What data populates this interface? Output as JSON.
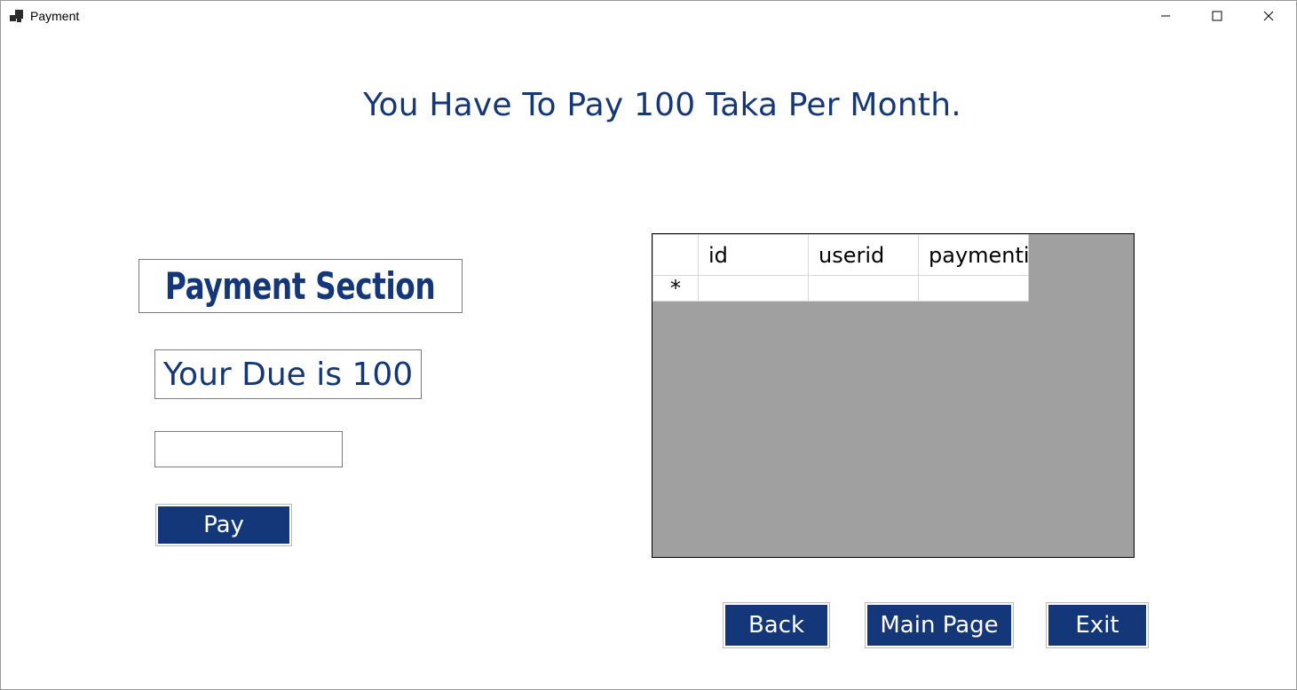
{
  "window": {
    "title": "Payment"
  },
  "headline": "You Have To Pay 100 Taka Per Month.",
  "section": {
    "title": "Payment Section"
  },
  "due": {
    "text": "Your Due is 100"
  },
  "amount_input": {
    "value": "",
    "placeholder": ""
  },
  "buttons": {
    "pay": "Pay",
    "back": "Back",
    "main_page": "Main Page",
    "exit": "Exit"
  },
  "grid": {
    "columns": [
      "id",
      "userid",
      "paymenti"
    ],
    "new_row_marker": "*",
    "rows": []
  },
  "colors": {
    "accent": "#14377a",
    "grid_background": "#a0a0a0"
  },
  "icons": {
    "app": "app-icon",
    "minimize": "minimize-icon",
    "maximize": "maximize-icon",
    "close": "close-icon"
  }
}
